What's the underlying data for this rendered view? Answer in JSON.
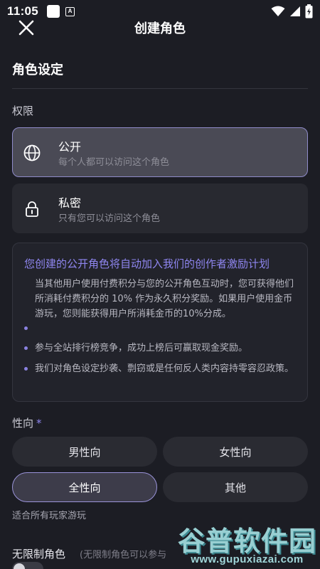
{
  "status_bar": {
    "time": "11:05",
    "notification_badge": "A"
  },
  "header": {
    "title": "创建角色"
  },
  "section": {
    "title": "角色设定"
  },
  "permission": {
    "label": "权限",
    "options": [
      {
        "title": "公开",
        "desc": "每个人都可以访问这个角色",
        "selected": true,
        "icon": "globe-icon"
      },
      {
        "title": "私密",
        "desc": "只有您可以访问这个角色",
        "selected": false,
        "icon": "lock-icon"
      }
    ]
  },
  "incentive": {
    "heading": "您创建的公开角色将自动加入我们的创作者激励计划",
    "items": [
      "当其他用户使用付费积分与您的公开角色互动时，您可获得他们所消耗付费积分的 10% 作为永久积分奖励。如果用户使用金币游玩，您则能获得用户所消耗金币的10%分成。",
      "参与全站排行榜竞争，成功上榜后可赢取现金奖励。",
      "我们对角色设定抄袭、剽窃或是任何反人类内容持零容忍政策。"
    ]
  },
  "orientation": {
    "label": "性向",
    "required_mark": "*",
    "options": [
      "男性向",
      "女性向",
      "全性向",
      "其他"
    ],
    "selected": "全性向",
    "hint": "适合所有玩家游玩"
  },
  "unlimited": {
    "label": "无限制角色",
    "note": "(无限制角色可以参与",
    "enabled": false
  },
  "watermark": {
    "text": "谷普软件园",
    "url": "www.gupuxiazai.com"
  },
  "colors": {
    "background": "#1c1d24",
    "accent": "#8f86f0",
    "card": "#282930",
    "selected_card": "#4a4a55"
  }
}
